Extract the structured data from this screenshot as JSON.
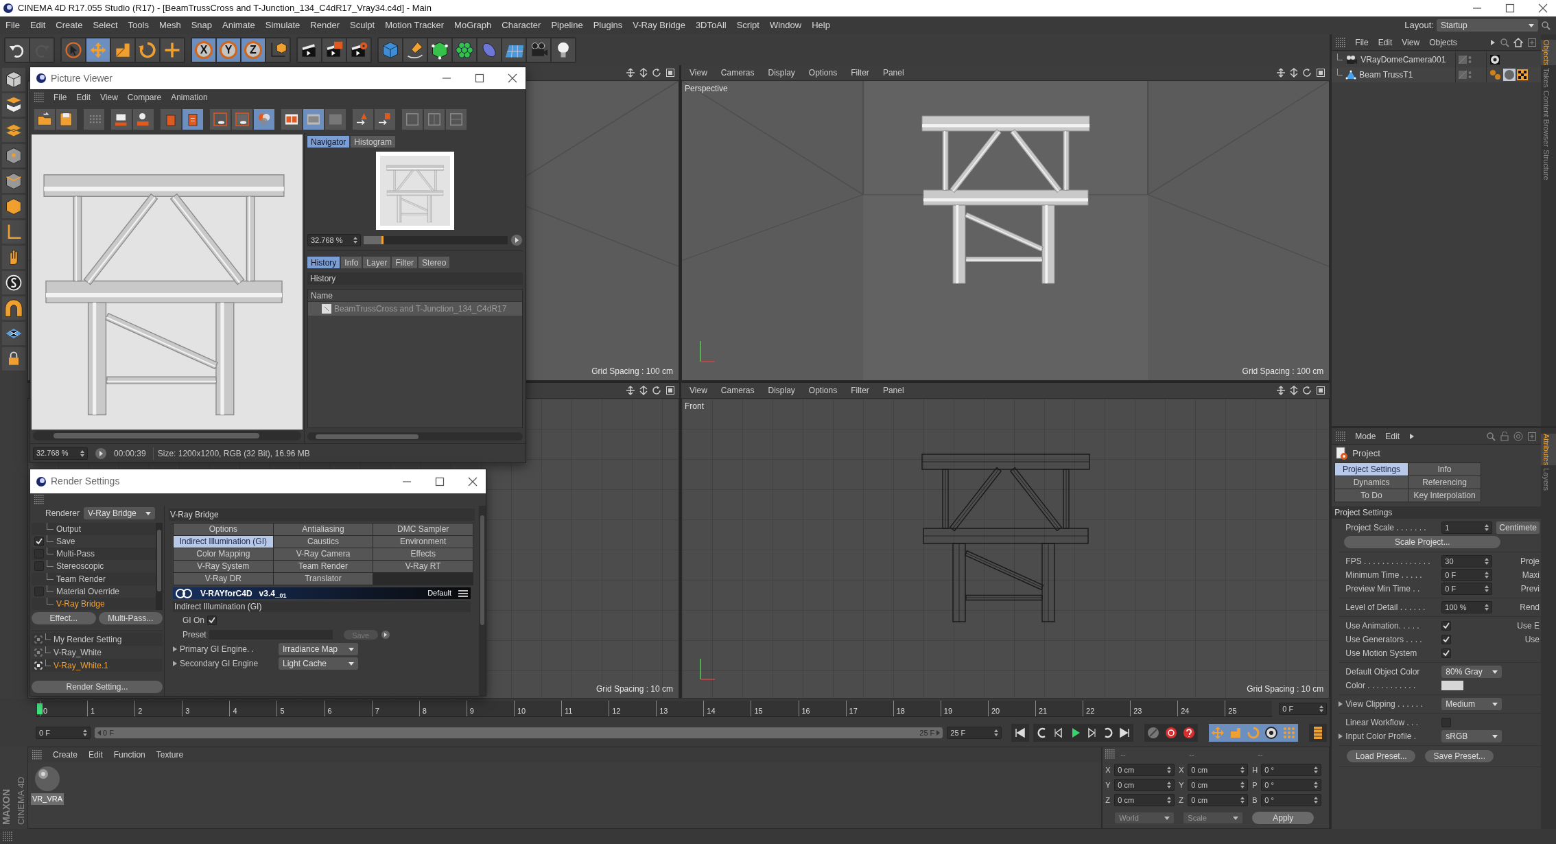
{
  "window": {
    "title": "CINEMA 4D R17.055 Studio (R17) - [BeamTrussCross and T-Junction_134_C4dR17_Vray34.c4d] - Main"
  },
  "menu": [
    "File",
    "Edit",
    "Create",
    "Select",
    "Tools",
    "Mesh",
    "Snap",
    "Animate",
    "Simulate",
    "Render",
    "Sculpt",
    "Motion Tracker",
    "MoGraph",
    "Character",
    "Pipeline",
    "Plugins",
    "V-Ray Bridge",
    "3DToAll",
    "Script",
    "Window",
    "Help"
  ],
  "layout": {
    "label": "Layout:",
    "value": "Startup"
  },
  "toolbar": [
    [
      {
        "kind": "undo",
        "selected": false
      },
      {
        "kind": "redo",
        "selected": false
      }
    ],
    [
      {
        "kind": "select",
        "selected": false
      },
      {
        "kind": "move",
        "selected": true
      },
      {
        "kind": "scale",
        "selected": false
      },
      {
        "kind": "rotate",
        "selected": false
      },
      {
        "kind": "transform",
        "selected": false
      }
    ],
    [
      {
        "kind": "axis",
        "label": "X",
        "selected": true
      },
      {
        "kind": "axis",
        "label": "Y",
        "selected": true
      },
      {
        "kind": "axis",
        "label": "Z",
        "selected": true
      },
      {
        "kind": "coords",
        "selected": false
      }
    ],
    [
      {
        "kind": "render_view",
        "selected": false
      },
      {
        "kind": "render_pv",
        "selected": false
      },
      {
        "kind": "render_settings",
        "selected": false
      }
    ],
    [
      {
        "kind": "cube",
        "selected": false
      },
      {
        "kind": "pen",
        "selected": false
      },
      {
        "kind": "subdivide",
        "selected": false
      },
      {
        "kind": "cloner",
        "selected": false
      },
      {
        "kind": "deformer",
        "selected": false
      },
      {
        "kind": "floor",
        "selected": false
      },
      {
        "kind": "camera",
        "selected": false
      },
      {
        "kind": "light",
        "selected": false
      }
    ]
  ],
  "viewports": [
    {
      "kind": "perspective",
      "grid": "Grid Spacing : 100 cm"
    },
    {
      "kind": "perspective",
      "menus": [
        "View",
        "Cameras",
        "Display",
        "Options",
        "Filter",
        "Panel"
      ],
      "label": "Perspective",
      "grid": "Grid Spacing : 100 cm"
    },
    {
      "kind": "front",
      "grid": "Grid Spacing : 10 cm"
    },
    {
      "kind": "front",
      "menus": [
        "View",
        "Cameras",
        "Display",
        "Options",
        "Filter",
        "Panel"
      ],
      "label": "Front",
      "grid": "Grid Spacing : 10 cm"
    }
  ],
  "picture_viewer": {
    "title": "Picture Viewer",
    "menu": [
      "File",
      "Edit",
      "View",
      "Compare",
      "Animation"
    ],
    "nav_tabs": [
      {
        "label": "Navigator",
        "selected": true
      },
      {
        "label": "Histogram",
        "selected": false
      }
    ],
    "zoom": "32.768 %",
    "zoom_slider": {
      "level": 0.14
    },
    "info_tabs": [
      {
        "label": "History",
        "selected": true
      },
      {
        "label": "Info",
        "selected": false
      },
      {
        "label": "Layer",
        "selected": false
      },
      {
        "label": "Filter",
        "selected": false
      },
      {
        "label": "Stereo",
        "selected": false
      }
    ],
    "history_title": "History",
    "column": "Name",
    "rows": [
      "BeamTrussCross and T-Junction_134_C4dR17"
    ],
    "status": {
      "zoom": "32.768 %",
      "time": "00:00:39",
      "info": "Size: 1200x1200, RGB (32 Bit), 16.96 MB"
    }
  },
  "render_settings": {
    "title": "Render Settings",
    "renderer_label": "Renderer",
    "renderer": "V-Ray Bridge",
    "items": [
      {
        "label": "Output",
        "kind": "plain",
        "selected": false
      },
      {
        "label": "Save",
        "kind": "check",
        "checked": true,
        "selected": false
      },
      {
        "label": "Multi-Pass",
        "kind": "check",
        "checked": false,
        "selected": false
      },
      {
        "label": "Stereoscopic",
        "kind": "check",
        "checked": false,
        "selected": false
      },
      {
        "label": "Team Render",
        "kind": "plain",
        "selected": false
      },
      {
        "label": "Material Override",
        "kind": "check",
        "checked": false,
        "selected": false
      },
      {
        "label": "V-Ray Bridge",
        "kind": "plain",
        "selected": true
      }
    ],
    "buttons": [
      "Effect...",
      "Multi-Pass..."
    ],
    "settings": [
      {
        "label": "My Render Setting",
        "selected": false
      },
      {
        "label": "V-Ray_White",
        "selected": false
      },
      {
        "label": "V-Ray_White.1",
        "selected": true
      }
    ],
    "render_setting_button": "Render Setting...",
    "panel_title": "V-Ray Bridge",
    "tabs": [
      {
        "label": "Options",
        "selected": false
      },
      {
        "label": "Antialiasing",
        "selected": false
      },
      {
        "label": "DMC Sampler",
        "selected": false
      },
      {
        "label": "Indirect Illumination (GI)",
        "selected": true
      },
      {
        "label": "Caustics",
        "selected": false
      },
      {
        "label": "Environment",
        "selected": false
      },
      {
        "label": "Color Mapping",
        "selected": false
      },
      {
        "label": "V-Ray Camera",
        "selected": false
      },
      {
        "label": "Effects",
        "selected": false
      },
      {
        "label": "V-Ray System",
        "selected": false
      },
      {
        "label": "Team Render",
        "selected": false
      },
      {
        "label": "V-Ray RT",
        "selected": false
      },
      {
        "label": "V-Ray DR",
        "selected": false
      },
      {
        "label": "Translator",
        "selected": false
      }
    ],
    "banner": {
      "logo": "V-RAYforC4D",
      "version": "v3.4_$_{01}$",
      "preset": "Default"
    },
    "section": "Indirect Illumination (GI)",
    "gi_on": {
      "label": "GI On",
      "checked": true
    },
    "preset": {
      "label": "Preset",
      "button": "Save"
    },
    "engines": [
      {
        "label": "Primary GI Engine. .",
        "value": "Irradiance Map"
      },
      {
        "label": "Secondary GI Engine",
        "value": "Light Cache"
      }
    ]
  },
  "objects": {
    "menu": [
      "File",
      "Edit",
      "View",
      "Objects"
    ],
    "items": [
      {
        "name": "VRayDomeCamera001",
        "kind": "camera"
      },
      {
        "name": "Beam TrussT1",
        "kind": "mesh"
      }
    ],
    "side_tabs": [
      {
        "label": "Objects",
        "selected": true
      },
      {
        "label": "Takes",
        "selected": false
      },
      {
        "label": "Content Browser",
        "selected": false
      },
      {
        "label": "Structure",
        "selected": false
      }
    ]
  },
  "attributes": {
    "menu": [
      "Mode",
      "Edit"
    ],
    "header": "Project",
    "tabs": [
      {
        "label": "Project Settings",
        "selected": true
      },
      {
        "label": "Info",
        "selected": false
      },
      {
        "label": "Dynamics",
        "selected": false
      },
      {
        "label": "Referencing",
        "selected": false
      },
      {
        "label": "To Do",
        "selected": false
      },
      {
        "label": "Key Interpolation",
        "selected": false
      }
    ],
    "section": "Project Settings",
    "groups": [
      [
        {
          "kind": "field",
          "label": "Project Scale . . . . . . .",
          "value": "1",
          "extra_button": "Centimete"
        },
        {
          "kind": "button",
          "label": "Scale Project..."
        }
      ],
      [
        {
          "kind": "field",
          "label": "FPS . . . . . . . . . . . . . . .",
          "value": "30",
          "side": "Proje"
        },
        {
          "kind": "field",
          "label": "Minimum Time . . . . .",
          "value": "0 F",
          "side": "Maxi"
        },
        {
          "kind": "field",
          "label": "Preview Min Time . .",
          "value": "0 F",
          "side": "Previ"
        }
      ],
      [
        {
          "kind": "field",
          "label": "Level of Detail . . . . . .",
          "value": "100 %",
          "side": "Rend"
        }
      ],
      [
        {
          "kind": "check",
          "label": "Use Animation. . . . .",
          "checked": true,
          "side": "Use E"
        },
        {
          "kind": "check",
          "label": "Use Generators . . . .",
          "checked": true,
          "side": "Use"
        },
        {
          "kind": "check",
          "label": "Use Motion System",
          "checked": true
        }
      ],
      [
        {
          "kind": "dropdown",
          "label": "Default Object Color",
          "value": "80% Gray"
        },
        {
          "kind": "color",
          "label": "Color . . . . . . . . . . .",
          "color": "#d6d6d6"
        }
      ],
      [
        {
          "kind": "dropdown",
          "label": "View Clipping . . . . . .",
          "value": "Medium",
          "expandable": true
        }
      ],
      [
        {
          "kind": "check",
          "label": "Linear Workflow . . .",
          "checked": false
        },
        {
          "kind": "dropdown",
          "label": "Input Color Profile .",
          "value": "sRGB",
          "expandable": true
        }
      ],
      [
        {
          "kind": "buttons",
          "labels": [
            "Load Preset...",
            "Save Preset..."
          ]
        }
      ]
    ],
    "side_tabs": [
      {
        "label": "Attributes",
        "selected": true
      },
      {
        "label": "Layers",
        "selected": false
      }
    ]
  },
  "timeline": {
    "ticks": [
      "0",
      "1",
      "2",
      "3",
      "4",
      "5",
      "6",
      "7",
      "8",
      "9",
      "10",
      "11",
      "12",
      "13",
      "14",
      "15",
      "16",
      "17",
      "18",
      "19",
      "20",
      "21",
      "22",
      "23",
      "24",
      "25"
    ],
    "current": "0 F",
    "start": "0 F",
    "range_start": "0 F",
    "range_bar": {
      "level": 1
    },
    "range_end": "25 F",
    "end": "25 F"
  },
  "branding": [
    "MAXON",
    "CINEMA 4D"
  ],
  "materials": {
    "menu": [
      "Create",
      "Edit",
      "Function",
      "Texture"
    ],
    "items": [
      {
        "name": "VR_VRA",
        "selected": true
      }
    ]
  },
  "coordinates": {
    "headers": [
      "--",
      "--",
      "--"
    ],
    "rows": [
      [
        {
          "axis": "X",
          "value": "0 cm"
        },
        {
          "axis": "X",
          "value": "0 cm"
        },
        {
          "axis": "H",
          "value": "0 °"
        }
      ],
      [
        {
          "axis": "Y",
          "value": "0 cm"
        },
        {
          "axis": "Y",
          "value": "0 cm"
        },
        {
          "axis": "P",
          "value": "0 °"
        }
      ],
      [
        {
          "axis": "Z",
          "value": "0 cm"
        },
        {
          "axis": "Z",
          "value": "0 cm"
        },
        {
          "axis": "B",
          "value": "0 °"
        }
      ]
    ],
    "modes": [
      "World",
      "Scale"
    ],
    "apply": "Apply"
  }
}
